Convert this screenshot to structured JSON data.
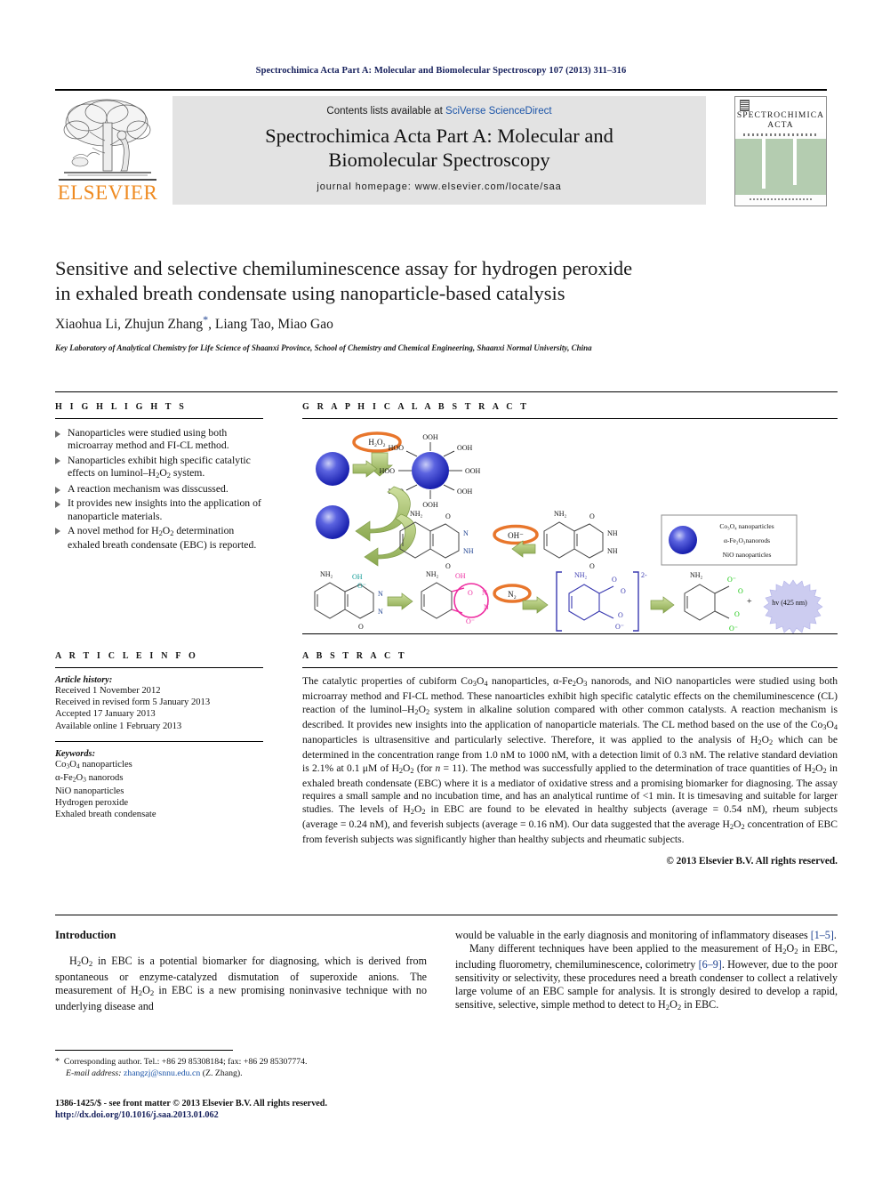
{
  "running_head": "Spectrochimica Acta Part A: Molecular and Biomolecular Spectroscopy 107 (2013) 311–316",
  "masthead": {
    "publisher_name": "ELSEVIER",
    "contents_prefix": "Contents lists available at ",
    "contents_link": "SciVerse ScienceDirect",
    "journal_title_line1": "Spectrochimica Acta Part A: Molecular and",
    "journal_title_line2": "Biomolecular Spectroscopy",
    "homepage": "journal homepage: www.elsevier.com/locate/saa",
    "cover_line1": "SPECTROCHIMICA",
    "cover_line2": "ACTA"
  },
  "article": {
    "title_line1": "Sensitive and selective chemiluminescence assay for hydrogen peroxide",
    "title_line2": "in exhaled breath condensate using nanoparticle-based catalysis",
    "authors": "Xiaohua Li, Zhujun Zhang",
    "authors_tail": ", Liang Tao, Miao Gao",
    "corresponding_marker": "*",
    "affiliation": "Key Laboratory of Analytical Chemistry for Life Science of Shaanxi Province, School of Chemistry and Chemical Engineering, Shaanxi Normal University, China"
  },
  "highlights": {
    "heading": "H I G H L I G H T S",
    "items": [
      "Nanoparticles were studied using both microarray method and FI-CL method.",
      "Nanoparticles exhibit high specific catalytic effects on luminol–H2O2 system.",
      "A reaction mechanism was disscussed.",
      "It provides new insights into the application of nanoparticle materials.",
      "A novel method for H2O2 determination exhaled breath condensate (EBC) is reported."
    ]
  },
  "article_info": {
    "heading": "A R T I C L E    I N F O",
    "history_label": "Article history:",
    "history": [
      "Received 1 November 2012",
      "Received in revised form 5 January 2013",
      "Accepted 17 January 2013",
      "Available online 1 February 2013"
    ],
    "keywords_label": "Keywords:",
    "keywords": [
      "Co3O4 nanoparticles",
      "α-Fe2O3 nanorods",
      "NiO nanoparticles",
      "Hydrogen peroxide",
      "Exhaled breath condensate"
    ]
  },
  "graphical_abstract": {
    "heading": "G R A P H I C A L   A B S T R A C T",
    "labels": {
      "reactant": "H2O2",
      "hydroxide": "OH–",
      "nitrogen": "N2",
      "emission": "hv (425 nm)",
      "peroxide_groups": [
        "OOH",
        "HOO",
        "OOH",
        "HOO",
        "OOH",
        "HOO",
        "OOH",
        "OOH"
      ],
      "amine": "NH2",
      "nh": "NH",
      "oxygen": "O",
      "oxygen_anion": "O–"
    },
    "legend": [
      "Co3O4 nanoparticles",
      "α-Fe2O3 nanorods",
      "NiO nanoparticles"
    ],
    "colors": {
      "nanoparticle": "#1b24c8",
      "arrow_green": "#9fbf63",
      "ellipse_orange": "#e8762c",
      "emission_burst": "#ccccf0",
      "magenta": "#ee2ca0",
      "teal": "#129b96",
      "bright_green": "#16c60c"
    }
  },
  "abstract": {
    "heading": "A B S T R A C T",
    "paragraph": "The catalytic properties of cubiform Co3O4 nanoparticles, α-Fe2O3 nanorods, and NiO nanoparticles were studied using both microarray method and FI-CL method. These nanoarticles exhibit high specific catalytic effects on the chemiluminescence (CL) reaction of the luminol–H2O2 system in alkaline solution compared with other common catalysts. A reaction mechanism is described. It provides new insights into the application of nanoparticle materials. The CL method based on the use of the Co3O4 nanoparticles is ultrasensitive and particularly selective. Therefore, it was applied to the analysis of H2O2 which can be determined in the concentration range from 1.0 nM to 1000 nM, with a detection limit of 0.3 nM. The relative standard deviation is 2.1% at 0.1 μM of H2O2 (for n = 11). The method was successfully applied to the determination of trace quantities of H2O2 in exhaled breath condensate (EBC) where it is a mediator of oxidative stress and a promising biomarker for diagnosing. The assay requires a small sample and no incubation time, and has an analytical runtime of <1 min. It is timesaving and suitable for larger studies. The levels of H2O2 in EBC are found to be elevated in healthy subjects (average = 0.54 nM), rheum subjects (average = 0.24 nM), and feverish subjects (average = 0.16 nM). Our data suggested that the average H2O2 concentration of EBC from feverish subjects was significantly higher than healthy subjects and rheumatic subjects.",
    "copyright": "© 2013 Elsevier B.V. All rights reserved."
  },
  "body": {
    "section_heading": "Introduction",
    "col_left_para1": "H2O2 in EBC is a potential biomarker for diagnosing, which is derived from spontaneous or enzyme-catalyzed dismutation of superoxide anions. The measurement of H2O2 in EBC is a new promising noninvasive technique with no underlying disease and",
    "col_right_para1_cont": "would be valuable in the early diagnosis and monitoring of inflammatory diseases [1–5].",
    "col_right_para2": "Many different techniques have been applied to the measurement of H2O2 in EBC, including fluorometry, chemiluminescence, colorimetry [6–9]. However, due to the poor sensitivity or selectivity, these procedures need a breath condenser to collect a relatively large volume of an EBC sample for analysis. It is strongly desired to develop a rapid, sensitive, selective, simple method to detect to H2O2 in EBC."
  },
  "footnote": {
    "marker": "*",
    "corresponding": "Corresponding author. Tel.: +86 29 85308184; fax: +86 29 85307774.",
    "email_label": "E-mail address:",
    "email": "zhangzj@snnu.edu.cn",
    "email_suffix": "(Z. Zhang)."
  },
  "footer": {
    "issn_line": "1386-1425/$ - see front matter © 2013 Elsevier B.V. All rights reserved.",
    "doi": "http://dx.doi.org/10.1016/j.saa.2013.01.062"
  }
}
